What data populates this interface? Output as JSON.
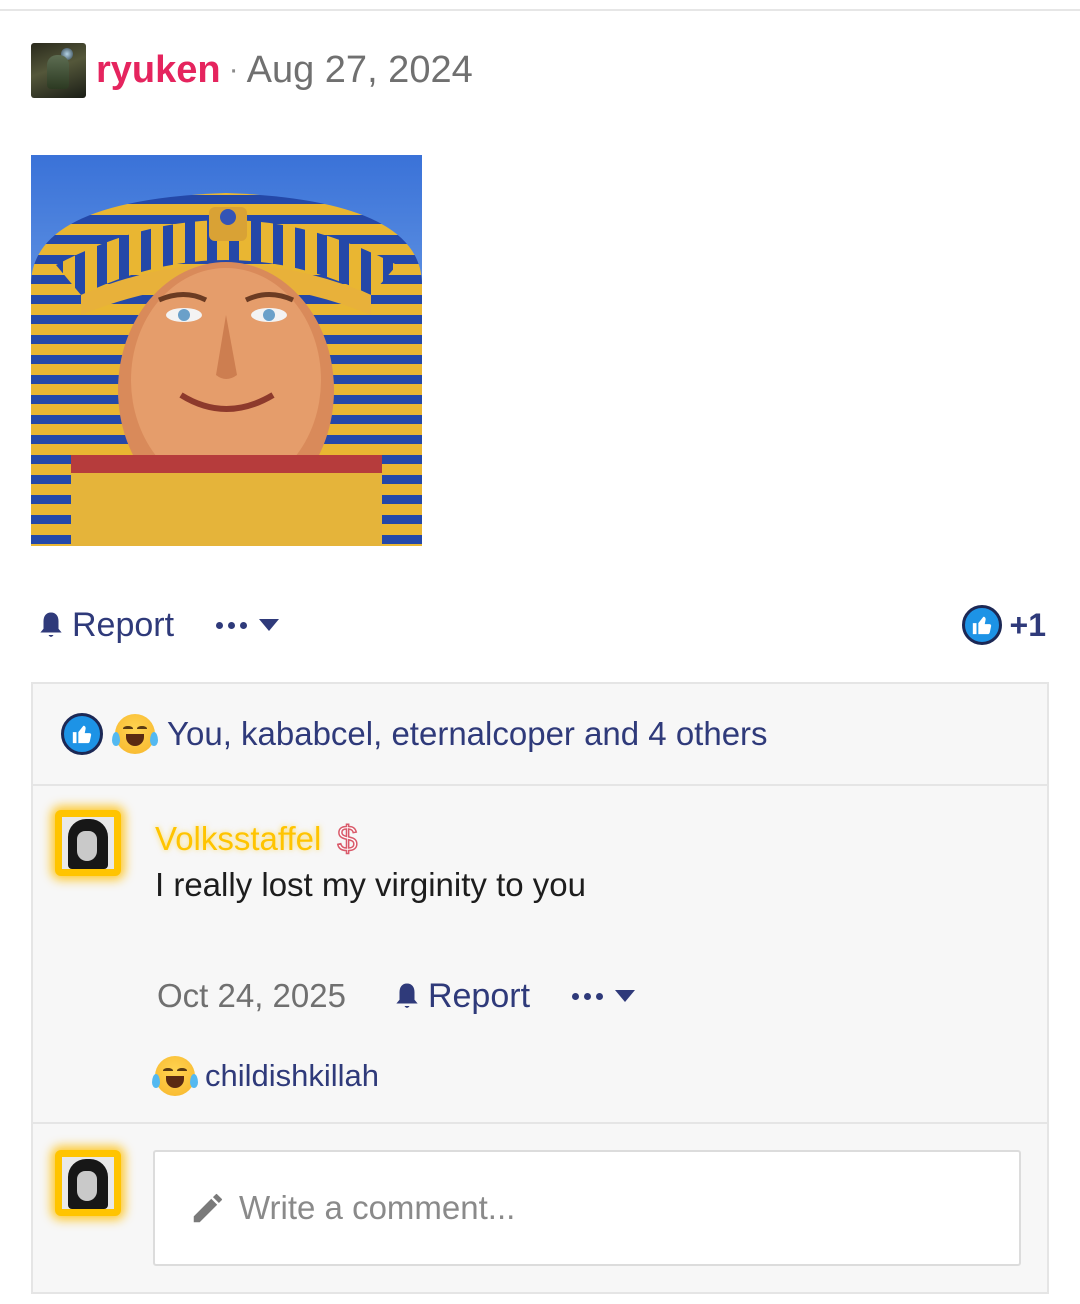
{
  "post": {
    "author": "ryuken",
    "separator": "·",
    "date": "Aug 27, 2024",
    "image_alt": "pharaoh-portrait"
  },
  "actions": {
    "report_label": "Report",
    "reaction_count": "+1"
  },
  "reactions": {
    "summary_text": "You, kababcel, eternalcoper and 4 others",
    "icons": [
      "like-icon",
      "laugh-cry-icon"
    ]
  },
  "comment": {
    "author": "Volksstaffel",
    "badge": "$",
    "body": "I really lost my virginity to you",
    "date": "Oct 24, 2025",
    "report_label": "Report",
    "reaction_user": "childishkillah"
  },
  "composer": {
    "placeholder": "Write a comment..."
  },
  "colors": {
    "author_pink": "#e5245e",
    "link_navy": "#2f3a7a",
    "gold_name": "#ffc400",
    "like_blue": "#1d93e6"
  }
}
